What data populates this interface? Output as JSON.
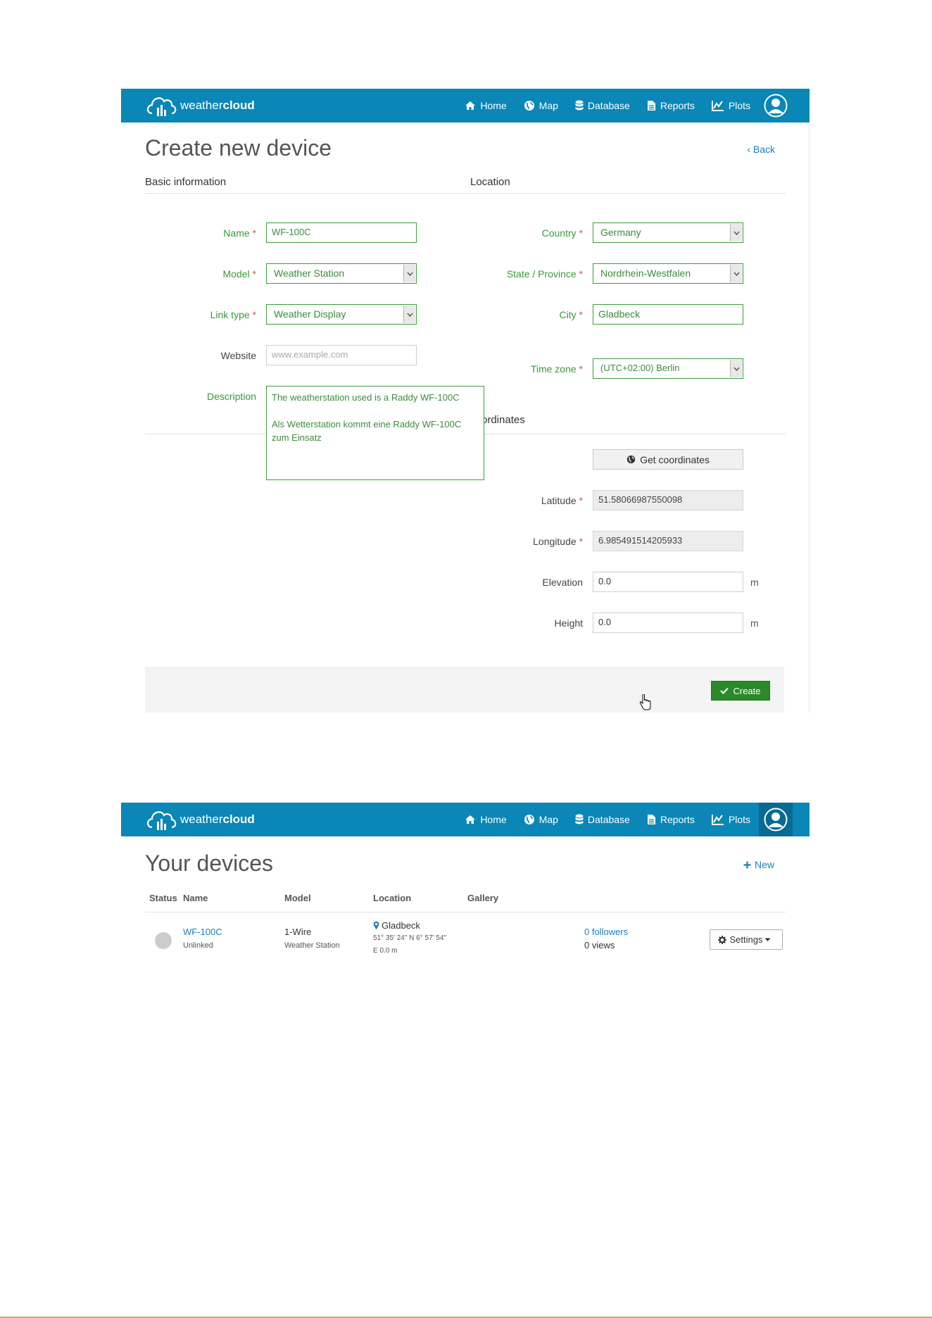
{
  "colors": {
    "navbar": "#0a86b7",
    "accent_green": "#2a8a2a",
    "link_blue": "#1a82b8",
    "required_green": "#3a9a3a"
  },
  "brand": {
    "part1": "weather",
    "part2": "cloud"
  },
  "nav": [
    {
      "label": "Home",
      "icon": "home-icon"
    },
    {
      "label": "Map",
      "icon": "globe-icon"
    },
    {
      "label": "Database",
      "icon": "database-icon"
    },
    {
      "label": "Reports",
      "icon": "document-icon"
    },
    {
      "label": "Plots",
      "icon": "line-chart-icon"
    }
  ],
  "create_form": {
    "title": "Create new device",
    "back": "Back",
    "basic_heading": "Basic information",
    "location_heading": "Location",
    "coordinates_heading": "Coordinates",
    "coordinates_visible_text": "ordinates",
    "required_mark": "*",
    "name": {
      "label": "Name",
      "value": "WF-100C"
    },
    "model": {
      "label": "Model",
      "value": "Weather Station"
    },
    "link_type": {
      "label": "Link type",
      "value": "Weather Display"
    },
    "website": {
      "label": "Website",
      "placeholder": "www.example.com"
    },
    "description": {
      "label": "Description",
      "value": "The weatherstation used is a Raddy WF-100C\n\nAls Wetterstation kommt eine Raddy WF-100C\nzum Einsatz"
    },
    "country": {
      "label": "Country",
      "value": "Germany"
    },
    "state": {
      "label": "State / Province",
      "value": "Nordrhein-Westfalen"
    },
    "city": {
      "label": "City",
      "value": "Gladbeck"
    },
    "timezone": {
      "label": "Time zone",
      "value": "(UTC+02:00) Berlin"
    },
    "get_coordinates": "Get coordinates",
    "latitude": {
      "label": "Latitude",
      "value": "51.58066987550098"
    },
    "longitude": {
      "label": "Longitude",
      "value": "6.985491514205933"
    },
    "elevation": {
      "label": "Elevation",
      "value": "0.0",
      "unit": "m"
    },
    "height": {
      "label": "Height",
      "value": "0.0",
      "unit": "m"
    },
    "create_button": "Create"
  },
  "devices": {
    "title": "Your devices",
    "new_link": "New",
    "columns": [
      "Status",
      "Name",
      "Model",
      "Location",
      "Gallery"
    ],
    "rows": [
      {
        "name": "WF-100C",
        "link_status": "Unlinked",
        "model_type": "1-Wire",
        "model_name": "Weather Station",
        "city": "Gladbeck",
        "coords": "51° 35' 24\" N  6° 57' 54\"",
        "coords2": "E  0.0 m",
        "followers": "0 followers",
        "views": "0 views",
        "settings": "Settings"
      }
    ]
  }
}
